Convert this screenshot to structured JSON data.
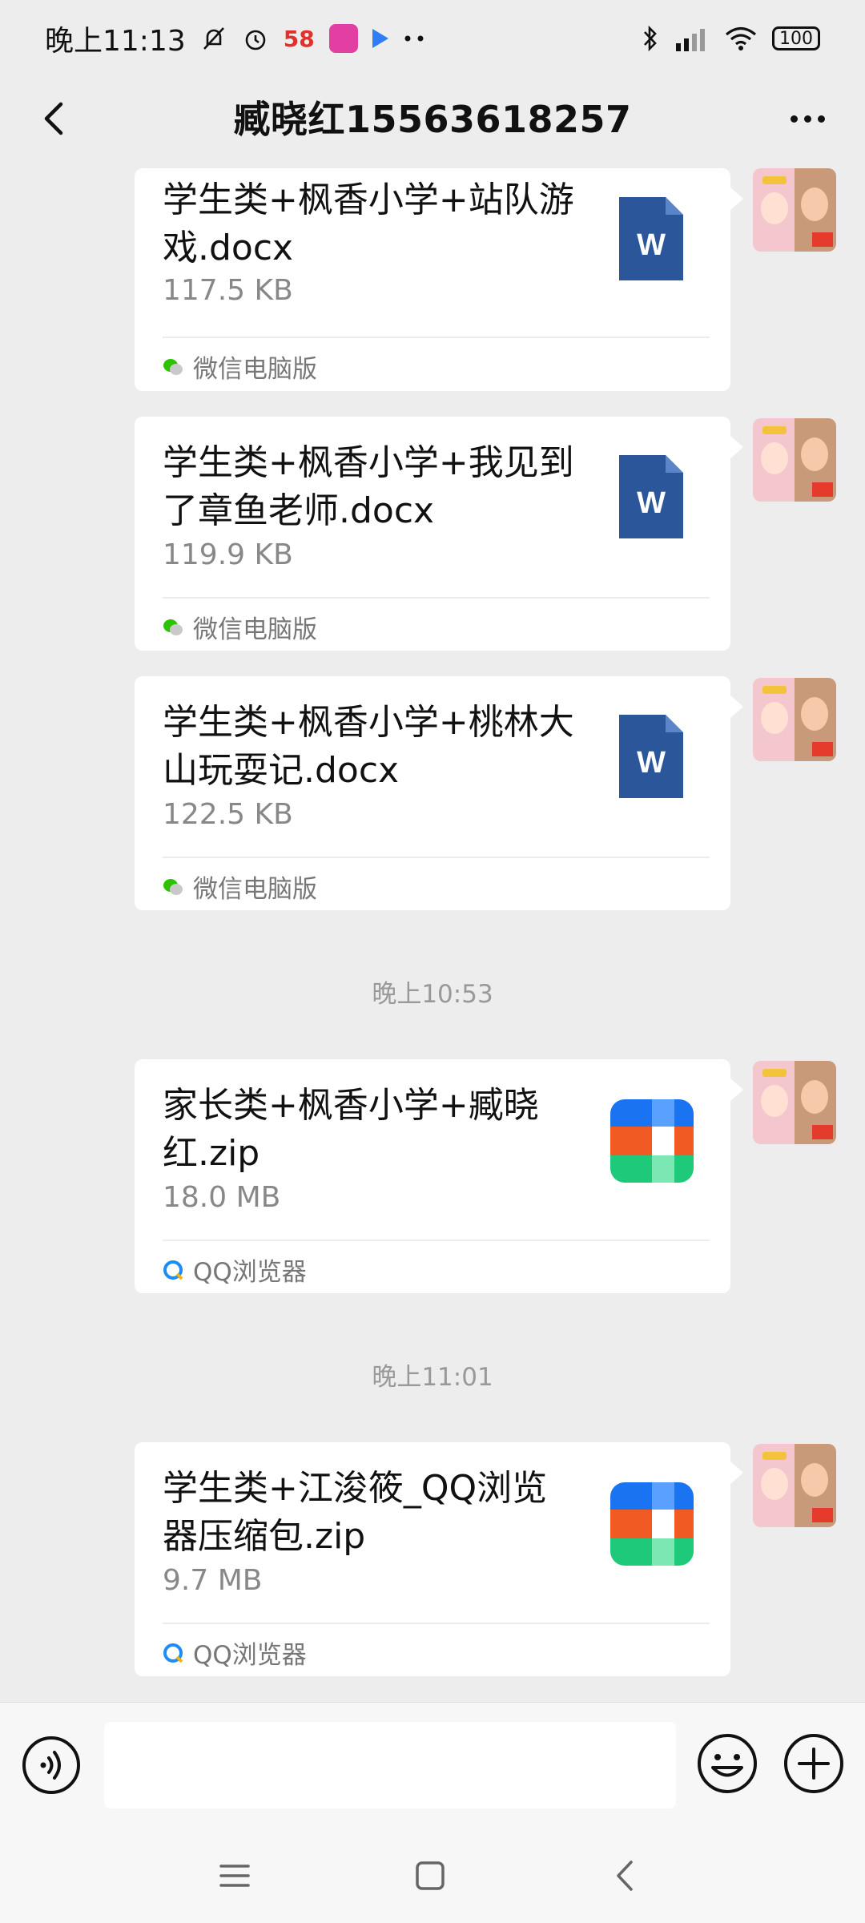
{
  "status_bar": {
    "time": "晚上11:13",
    "app_58": "58",
    "battery": "100"
  },
  "header": {
    "title": "臧晓红15563618257"
  },
  "messages": [
    {
      "file_name": "学生类+枫香小学+站队游戏.docx",
      "size": "117.5 KB",
      "source": "微信电脑版",
      "type": "word"
    },
    {
      "file_name": "学生类+枫香小学+我见到了章鱼老师.docx",
      "size": "119.9 KB",
      "source": "微信电脑版",
      "type": "word"
    },
    {
      "file_name": "学生类+枫香小学+桃林大山玩耍记.docx",
      "size": "122.5 KB",
      "source": "微信电脑版",
      "type": "word"
    },
    {
      "file_name": "家长类+枫香小学+臧晓红.zip",
      "size": "18.0 MB",
      "source": "QQ浏览器",
      "type": "zip"
    },
    {
      "file_name": "学生类+江浚筱_QQ浏览器压缩包.zip",
      "size": "9.7 MB",
      "source": "QQ浏览器",
      "type": "zip"
    }
  ],
  "time_separators": [
    "晚上10:53",
    "晚上11:01"
  ],
  "colors": {
    "word_blue": "#2b579a",
    "zip_blue": "#1a73f0",
    "zip_orange": "#f15a22",
    "zip_green": "#1fc97a",
    "wechat_green": "#2dc100",
    "qq_blue": "#1d8cf8"
  },
  "icons": {
    "back": "back-chevron-icon",
    "more": "more-dots-icon",
    "voice": "voice-icon",
    "emoji": "emoji-icon",
    "plus": "plus-icon"
  }
}
